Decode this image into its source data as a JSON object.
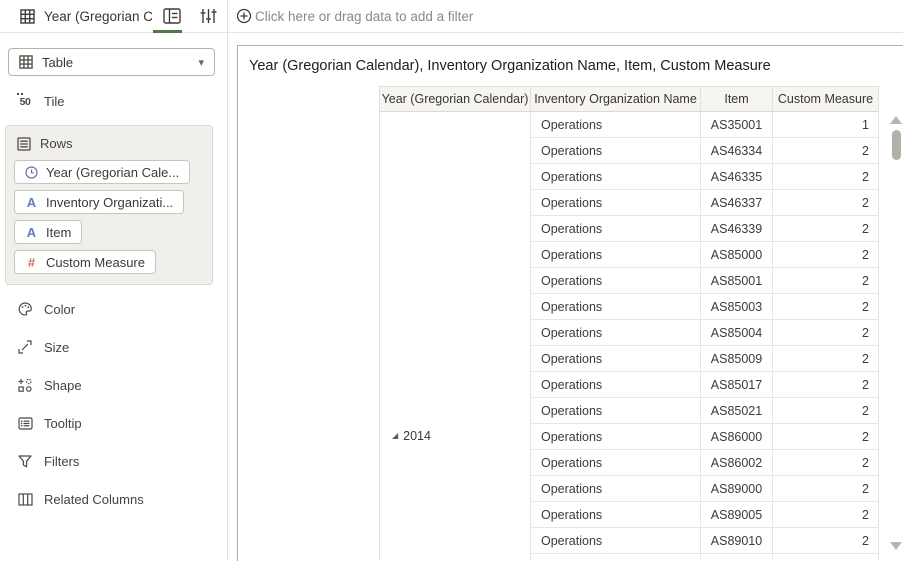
{
  "topbar": {
    "title": "Year (Gregorian Cal...",
    "filter_prompt": "Click here or drag data to add a filter"
  },
  "icons": {
    "chevron_down": "▾",
    "attribute": "A",
    "number": "#",
    "tile_number": "50"
  },
  "colors": {
    "accent_green": "#4c7a44",
    "selection_border": "#a9b59e",
    "clock_purple": "#7b68ae",
    "attribute_blue": "#5d7cc4",
    "measure_orange": "#d0705a"
  },
  "sidebar": {
    "visualization_type": "Table",
    "tile_label": "Tile",
    "rows_section": {
      "label": "Rows",
      "pills": [
        {
          "label": "Year (Gregorian Cale...",
          "icon": "clock-icon"
        },
        {
          "label": "Inventory Organizati...",
          "icon": "attribute-icon"
        },
        {
          "label": "Item",
          "icon": "attribute-icon"
        },
        {
          "label": "Custom Measure",
          "icon": "number-icon"
        }
      ]
    },
    "items": [
      {
        "label": "Color"
      },
      {
        "label": "Size"
      },
      {
        "label": "Shape"
      },
      {
        "label": "Tooltip"
      },
      {
        "label": "Filters"
      },
      {
        "label": "Related Columns"
      }
    ]
  },
  "main": {
    "title": "Year (Gregorian Calendar), Inventory Organization Name, Item, Custom Measure",
    "table": {
      "columns": [
        "Year (Gregorian Calendar)",
        "Inventory Organization Name",
        "Item",
        "Custom Measure"
      ],
      "year_group": {
        "marker": "◢",
        "label": "2014"
      },
      "rows": [
        {
          "org": "Operations",
          "item": "AS35001",
          "value": "1"
        },
        {
          "org": "Operations",
          "item": "AS46334",
          "value": "2"
        },
        {
          "org": "Operations",
          "item": "AS46335",
          "value": "2"
        },
        {
          "org": "Operations",
          "item": "AS46337",
          "value": "2"
        },
        {
          "org": "Operations",
          "item": "AS46339",
          "value": "2"
        },
        {
          "org": "Operations",
          "item": "AS85000",
          "value": "2"
        },
        {
          "org": "Operations",
          "item": "AS85001",
          "value": "2"
        },
        {
          "org": "Operations",
          "item": "AS85003",
          "value": "2"
        },
        {
          "org": "Operations",
          "item": "AS85004",
          "value": "2"
        },
        {
          "org": "Operations",
          "item": "AS85009",
          "value": "2"
        },
        {
          "org": "Operations",
          "item": "AS85017",
          "value": "2"
        },
        {
          "org": "Operations",
          "item": "AS85021",
          "value": "2"
        },
        {
          "org": "Operations",
          "item": "AS86000",
          "value": "2"
        },
        {
          "org": "Operations",
          "item": "AS86002",
          "value": "2"
        },
        {
          "org": "Operations",
          "item": "AS89000",
          "value": "2"
        },
        {
          "org": "Operations",
          "item": "AS89005",
          "value": "2"
        },
        {
          "org": "Operations",
          "item": "AS89010",
          "value": "2"
        }
      ]
    }
  }
}
